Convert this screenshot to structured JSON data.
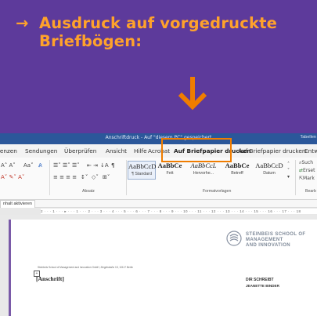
{
  "banner": {
    "arrow": "→",
    "line1": "Ausdruck auf vorgedruckte",
    "line2": "Briefbögen:"
  },
  "titlebar": {
    "title": "Anschriftdruck - Auf \"diesem PC\" gespeichert",
    "tabellen": "Tabellen"
  },
  "ribbon_tabs": [
    "renzen",
    "Sendungen",
    "Überprüfen",
    "Ansicht",
    "Hilfe",
    "Acrobat",
    "Auf Briefpapier drucken",
    "Auf Briefpapier drucken",
    "Entw"
  ],
  "ribbon": {
    "group_absatz": "Absatz",
    "group_formatvorlagen": "Formatvorlagen",
    "group_bearbeiten": "Bearb",
    "styles": [
      {
        "sample": "AaBbCcD",
        "name": "¶ Standard"
      },
      {
        "sample": "AaBbCe",
        "name": "Fett"
      },
      {
        "sample": "AaBbCcL",
        "name": "Hervorhe..."
      },
      {
        "sample": "AaBbCe",
        "name": "Betreff"
      },
      {
        "sample": "AaBbCcD",
        "name": "Datum"
      }
    ],
    "suchen": "Such",
    "ersetzen": "Erset",
    "markieren": "Mark"
  },
  "editbar": {
    "label": "nhalt aktivieren"
  },
  "ruler": {
    "text": "2 · · · 1 · · · ▸ · · · 1 · · · 2 · · · 3 · · · 4 · · · 5 · · · 6 · · · 7 · · · 8 · · · 9 · · · 10 · · · 11 · · · 12 · · · 13 · · · 14 · · · 15 · · · 16 · · · 17 · · · 18"
  },
  "document": {
    "logo_line1": "STEINBEIS SCHOOL OF",
    "logo_line2": "MANAGEMENT",
    "logo_line3": "AND INNOVATION",
    "sender_line": "Steinbeis School of Management and Innovation GmbH, Ziegelstraße 15, 10117 Berlin",
    "anschrift": "[Anschrift]",
    "dir_schreibt": "DIR SCHREIBT",
    "name_line": "JEANETTE BINDER"
  },
  "colors": {
    "banner_bg": "#5d3a9b",
    "banner_text": "#ffa22b",
    "callout": "#f07d00",
    "word_blue": "#2b579a"
  }
}
